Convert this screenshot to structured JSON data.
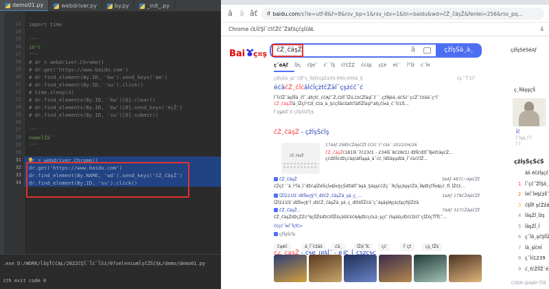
{
  "ide": {
    "tabs": [
      {
        "label": "demo01.py",
        "active": true
      },
      {
        "label": "webdriver.py",
        "active": false
      },
      {
        "label": "by.py",
        "active": false
      },
      {
        "label": "_init_.py",
        "active": false
      }
    ],
    "line_numbers": [
      "13",
      "14",
      "15",
      "16",
      "17",
      "18",
      "19",
      "20",
      "21",
      "22",
      "23",
      "24",
      "25",
      "26",
      "27",
      "28",
      "29",
      "30",
      "31",
      "32",
      "33",
      "34"
    ],
    "lines": [
      {
        "text": "import time",
        "style": "cm"
      },
      {
        "text": "",
        "style": ""
      },
      {
        "text": "'''",
        "style": "doc"
      },
      {
        "text": "1ä¹ć",
        "style": "doc"
      },
      {
        "text": "'''",
        "style": "doc"
      },
      {
        "text": "# dr = webdriver.Chrome()",
        "style": "cm"
      },
      {
        "text": "# dr.get('https://www.baidu.com')",
        "style": "cm"
      },
      {
        "text": "# dr.find_element(By.ID, 'kw').send_keys('ææ')",
        "style": "cm"
      },
      {
        "text": "# dr.find_element(By.ID, 'su').click()",
        "style": "cm"
      },
      {
        "text": "# time.sleep(3)",
        "style": "cm"
      },
      {
        "text": "# dr.find_elements(By.ID, 'kw')[0].clear()",
        "style": "cm"
      },
      {
        "text": "# dr.find_elements(By.ID, 'kw')[0].send_keys('éçŽ')",
        "style": "cm"
      },
      {
        "text": "# dr.find_elements(By.ID, 'su')[0].submit()",
        "style": "cm"
      },
      {
        "text": "",
        "style": ""
      },
      {
        "text": "'''",
        "style": "doc"
      },
      {
        "text": "nameĺŽä˝",
        "style": "doc"
      },
      {
        "text": "'''",
        "style": "doc"
      },
      {
        "text": "",
        "style": ""
      },
      {
        "text": "dr = webdriver.Chrome()",
        "style": "sel"
      },
      {
        "text": "dr.get('https://www.baidu.com')",
        "style": "sel"
      },
      {
        "text": "dr.find_element(By.NAME, 'wd').send_keys('čŻ¸čäşŽ')",
        "style": "sel"
      },
      {
        "text": "dr.find_element(By.ID, 'su').click()",
        "style": "sel"
      }
    ],
    "console_line1": ".exe D:/WORK/ĺäşŤććĄŁ/2022čŞĺ¨ĺć¨ĺšż/07seleniumĺşčŻŚč§Ł/demo/demo01.py",
    "console_line2": "ith exit code 0"
  },
  "browser": {
    "url_domain": "baidu.com",
    "url_path": "/s?ie=utf-8&f=8&rsv_bp=1&rsv_idx=1&tn=baidu&wd=čŻ¸čäşŽ&fenlei=256&rsv_pq...",
    "infobar_text": "Chrome ć­ŁĺčŞĺ¨ćľčŻč˝ŻäťśçćşĺśăŁ",
    "infobar_close": "â",
    "nav": {
      "back": "â",
      "forward": "â",
      "reload": "âť",
      "lock": "đ"
    }
  },
  "baidu": {
    "logo_text": "Bai",
    "logo_text2": "ç§ćžş",
    "logo_text3": "ç¤ş",
    "search_value": "čŻ¸čäşŽ",
    "clear_icon": "â",
    "search_button": "çžĺşŚä¸ä¸",
    "settings_label": "çžĺşŚéŚéĄľ",
    "tabs": [
      "ç˝éĄľ",
      "ĺžç",
      "č§é˘",
      "č´´ĺ§",
      "čľčŽŻ",
      "ććĄŁ",
      "çĽé",
      "éč´­",
      "ĺ°ĺž",
      "ć´ĺ¤"
    ],
    "result_count": "çžĺşŚä¸şć¨ćžĺ°ç¸ĺłçťćçşŚ100,000,000ä¸Ş",
    "search_tools": "ćç´˘ĺˇĽĺˇ",
    "results": [
      {
        "title_pre": "éćă",
        "title_hl": "čŻ¸čĺć",
        "title_post": "ăĺćĺçżťčŻâĺ¨çşżćč¨ć",
        "line1": "ĺ˝ĺć­ĺŽ˝äşĺĺĺä¸čľˇ,äťçťć˛ćčĄčˇŻ,čżĺĺ˝ĺŽś,čżćŻĺäşĺ˝č´¨,çžĺ§éä¸éčŚć¨çćŹ˘čżăä˝ç°ĺ¨",
        "line2_hl": "čŻ¸čäşŽ",
        "line2": "ĺä¸ĺŽçĺ°čżĺ˛čżä¸ä¸ŞćçĺĺăćšäťćľäťĺŽĺäşĺ°äťçćĺ¤ä¸ć¨ľćĽŠ...",
        "meta1": "ĺ¨çşżćč¨ć",
        "meta2": "çžĺşŚĺżŤç§"
      },
      {
        "title_hl": "čŻ¸čäşŽ",
        "title_post": " - çžĺşŚćĺş",
        "meta": "17éĄľ  2985ćŹĄéčŻť  ćčżć´ć°ćśé´:2022/04/26",
        "line1_hl": "čŻ¸čäşŽ",
        "line1": "(181ĺš´7ć23ćĽ - 234ĺš´8ć28ćĽ) ďźĺ­ĺćďźĺˇĺ§éž(äşćŹ...",
        "line2": "çć­ďźĺ­ĺćďźçćäş(äťĺąąä¸äˇćć˛ĺďźäşşďźä¸ĺ˝ćśćčĺŽ...",
        "image_label": "čŻ¸čäşŽ",
        "sub": [
          {
            "text": "čŻ¸čäşŽ",
            "pages": "3éĄľ",
            "views": "487ć¬ĄéčŻť"
          },
          {
            "text": "ĺŹĺ221ĺš´ďźĺĺ¤ç§°ĺ¸ďźčŻ¸čäşŽä¸şä¸ç¸...",
            "pages": "1éĄľ",
            "views": "178ćŹĄéčŻť"
          },
          {
            "text": "čŻ¸čäşŽ...",
            "pages": "7éĄľ",
            "views": "327ćŹĄéčŻť"
          }
        ],
        "sub_line1": "ćŽçč´¨ä¸ĺ°ĺä¸ĺ˝ďźćąĺŻéŚçĺ¤§ĺ¤ŞçŚďźäťĺ˘äşä¸ŞäşşććŻç´ ĺłçĺ­şçäşşćŹä¸ĺĄďźçľĺĺ¤§çć˛ťĺ˛ĺŻčż...",
        "sub_line2": "ĺŹĺ221ĺš´ďźĺĺ¤ç§°ĺ¸ďźčŻ¸čäşŽä¸şä¸ç¸ďźĺśĺĺŽćä˝çˇäşäşĺĄçśçťşçťŞĺŻźă",
        "sub_line3": "čŻ¸čäşŽďźçŹŹć°§çĺ­ĺŽśďźćźĺĺŽśçäšĺćśčĄĄďźćçć­Łä¸şçč´ćłąäšçďźćĽĺżćĺ¨çĺŽśçŤĺŤć˝...",
        "more": "ćĽçć´ĺ¤ĺ˝ĺçťć>",
        "source": "çžĺşŚćĺş"
      },
      {
        "title_hl": "čŻ¸čäşŽ",
        "title_post": " - č§é˘ĺ¤§ĺ¨ - éŤć¸ĺ¨çşżč§ç",
        "tags": [
          "čąéč",
          "ä¸ĺ˝ćźäš",
          "ćä¸",
          "ĺŽé˝ĺĽ",
          "çč",
          "ĺ¨çť",
          "çş¸ĺŽś"
        ]
      }
    ],
    "side": {
      "related_head": "ç¸ĺłäşşçŠ",
      "person_name": "ĺč",
      "person_desc1": "ĺ¨ĺşä¸ĺ˝ĺ",
      "person_desc2": "ĺ¨ĺ",
      "hot_head": "çžĺşŚçŚćŚ",
      "hot": [
        {
          "n": "",
          "text": "äš éčżĺşçč°č°"
        },
        {
          "n": "1",
          "text": "ĺ˝çč˝ŽĺŞä¸"
        },
        {
          "n": "2",
          "text": "ĺ¤ĺ˝ĺ¤§čżĺĺˇ"
        },
        {
          "n": "3",
          "text": "č§ĺĺť şčŽžä¸"
        },
        {
          "n": "4",
          "text": "ĺäşŹĺ¸ĺźş"
        },
        {
          "n": "5",
          "text": "ĺäşŹĺ¸ĺ"
        },
        {
          "n": "6",
          "text": "çˇĺ­ä¸şčŞĺĺŹ"
        },
        {
          "n": "7",
          "text": "ĺä¸şĺć­¤ĺ"
        },
        {
          "n": "8",
          "text": "çˇĺ­ćĽ239"
        },
        {
          "n": "9",
          "text": "ć˛ťćŽĺĺŽ´éž"
        }
      ],
      "watermark": "CSDN @äşťé°Čťš"
    }
  }
}
